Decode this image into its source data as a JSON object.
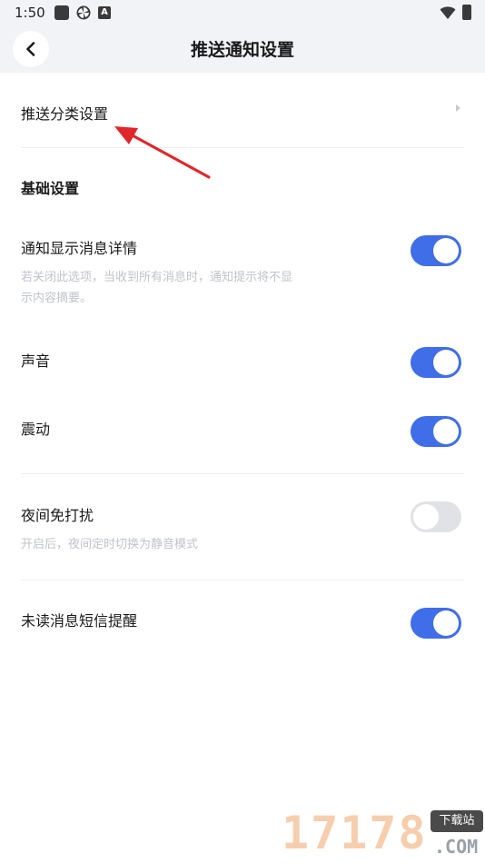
{
  "status_bar": {
    "time": "1:50",
    "icons": [
      "square-icon",
      "pinwheel-icon",
      "a-icon",
      "wifi-icon",
      "battery-icon"
    ],
    "a_icon_label": "A"
  },
  "header": {
    "title": "推送通知设置",
    "back_icon": "chevron-left-icon"
  },
  "push_category": {
    "label": "推送分类设置",
    "icon": "chevron-right-icon"
  },
  "basic_section": {
    "title": "基础设置",
    "items": [
      {
        "label": "通知显示消息详情",
        "description": "若关闭此选项，当收到所有消息时，通知提示将不显示内容摘要。",
        "enabled": true
      },
      {
        "label": "声音",
        "enabled": true
      },
      {
        "label": "震动",
        "enabled": true
      }
    ]
  },
  "night_mode": {
    "label": "夜间免打扰",
    "description": "开启后，夜间定时切换为静音模式",
    "enabled": false
  },
  "sms_reminder": {
    "label": "未读消息短信提醒",
    "enabled": true
  },
  "colors": {
    "accent": "#3f6ee8",
    "toggle_off": "#e1e2e6",
    "annotation_arrow": "#e0262b",
    "header_bg": "#f2f3f7"
  },
  "watermark": {
    "number": "17178",
    "tag": "下载站",
    "domain": ".COM"
  }
}
